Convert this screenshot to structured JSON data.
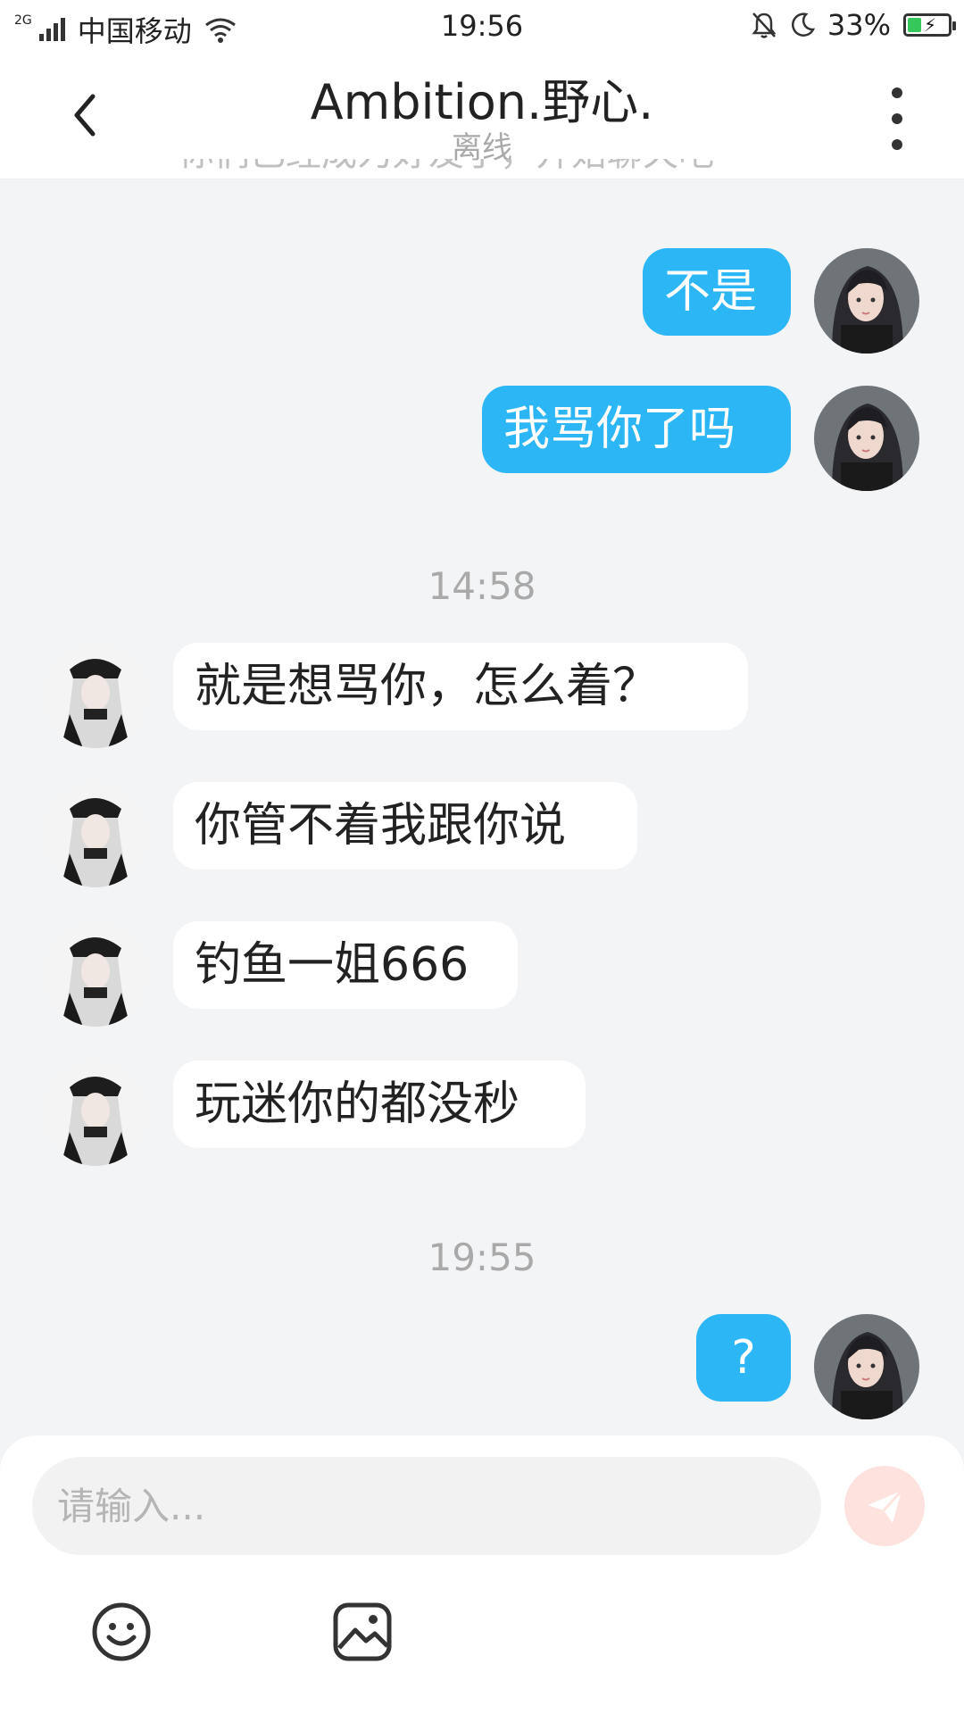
{
  "status_bar": {
    "network": "2G",
    "carrier": "中国移动",
    "time": "19:56",
    "battery": "33%",
    "battery_level": 0.33,
    "icons": [
      "signal-icon",
      "wifi-icon",
      "silent-bell-icon",
      "moon-icon",
      "battery-icon"
    ]
  },
  "header": {
    "title": "Ambition.野心.",
    "status": "离线"
  },
  "chat": {
    "cutoff_text": "你们已经成为好友了，开始聊天吧",
    "messages_top": [
      {
        "text": "不是"
      },
      {
        "text": "我骂你了吗"
      }
    ],
    "time_1": "14:58",
    "messages_mid": [
      {
        "text": "就是想骂你，怎么着？"
      },
      {
        "text": "你管不着我跟你说"
      },
      {
        "text": "钓鱼一姐666"
      },
      {
        "text": "玩迷你的都没秒"
      }
    ],
    "time_2": "19:55",
    "messages_bottom": [
      {
        "text": "?"
      }
    ]
  },
  "input": {
    "placeholder": "请输入..."
  },
  "colors": {
    "accent": "#2cb6f6",
    "send_button": "#fde2de",
    "background": "#f3f4f6"
  }
}
